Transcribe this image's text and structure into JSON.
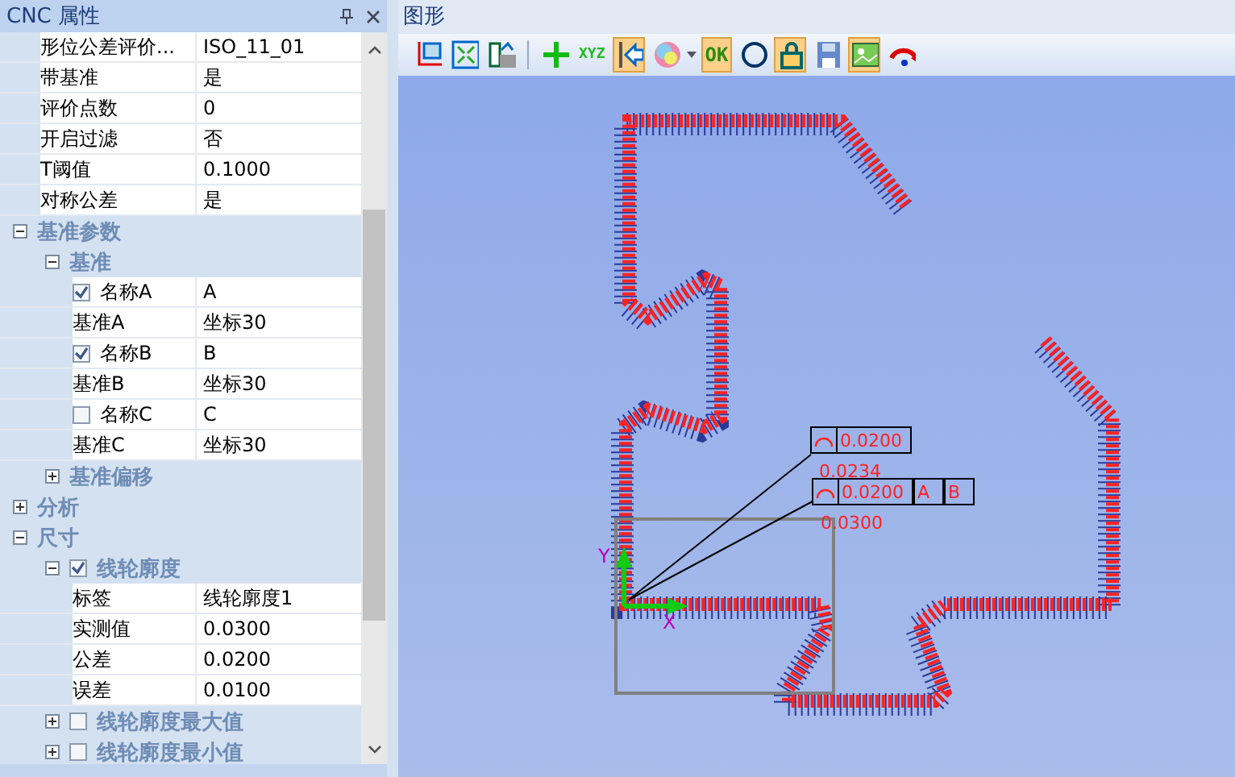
{
  "properties_panel": {
    "title": "CNC 属性",
    "items": [
      {
        "kind": "property",
        "label": "形位公差评价...",
        "value": "ISO_11_01"
      },
      {
        "kind": "property",
        "label": "带基准",
        "value": "是"
      },
      {
        "kind": "property",
        "label": "评价点数",
        "value": "0"
      },
      {
        "kind": "property",
        "label": "开启过滤",
        "value": "否"
      },
      {
        "kind": "property",
        "label": "T阈值",
        "value": "0.1000"
      },
      {
        "kind": "property",
        "label": "对称公差",
        "value": "是"
      },
      {
        "kind": "category",
        "label": "基准参数",
        "expanded": true,
        "children": [
          {
            "kind": "category",
            "label": "基准",
            "expanded": true,
            "children": [
              {
                "kind": "property",
                "label": "名称A",
                "value": "A",
                "checked": true
              },
              {
                "kind": "property",
                "label": "基准A",
                "value": "坐标30"
              },
              {
                "kind": "property",
                "label": "名称B",
                "value": "B",
                "checked": true
              },
              {
                "kind": "property",
                "label": "基准B",
                "value": "坐标30"
              },
              {
                "kind": "property",
                "label": "名称C",
                "value": "C",
                "checked": false
              },
              {
                "kind": "property",
                "label": "基准C",
                "value": "坐标30"
              }
            ]
          },
          {
            "kind": "category",
            "label": "基准偏移",
            "expanded": false
          }
        ]
      },
      {
        "kind": "category",
        "label": "分析",
        "expanded": false
      },
      {
        "kind": "category",
        "label": "尺寸",
        "expanded": true,
        "children": [
          {
            "kind": "category",
            "label": "线轮廓度",
            "expanded": true,
            "checked": true,
            "children": [
              {
                "kind": "property",
                "label": "标签",
                "value": "线轮廓度1"
              },
              {
                "kind": "property",
                "label": "实测值",
                "value": "0.0300"
              },
              {
                "kind": "property",
                "label": "公差",
                "value": "0.0200"
              },
              {
                "kind": "property",
                "label": "误差",
                "value": "0.0100"
              }
            ]
          },
          {
            "kind": "category",
            "label": "线轮廓度最大值",
            "expanded": false,
            "checked": false
          },
          {
            "kind": "category",
            "label": "线轮廓度最小值",
            "expanded": false,
            "checked": false
          }
        ]
      }
    ]
  },
  "graphics_panel": {
    "title": "图形",
    "toolbar": [
      {
        "pressed": false
      },
      {
        "pressed": false
      },
      {
        "pressed": false
      },
      {
        "pressed": false
      },
      {
        "pressed": false,
        "label": "XYZ"
      },
      {
        "pressed": true
      },
      {
        "pressed": false
      },
      {
        "pressed": true,
        "label": "OK"
      },
      {
        "pressed": false
      },
      {
        "pressed": true
      },
      {
        "pressed": false
      },
      {
        "pressed": true
      },
      {
        "pressed": false
      }
    ],
    "canvas": {
      "frames": [
        {
          "cells": [
            "0.0200"
          ],
          "reading": "0.0234"
        },
        {
          "cells": [
            "0.0200",
            "A",
            "B"
          ],
          "reading": "0.0300"
        }
      ],
      "axes": {
        "x": "X",
        "y": "Y"
      }
    }
  }
}
